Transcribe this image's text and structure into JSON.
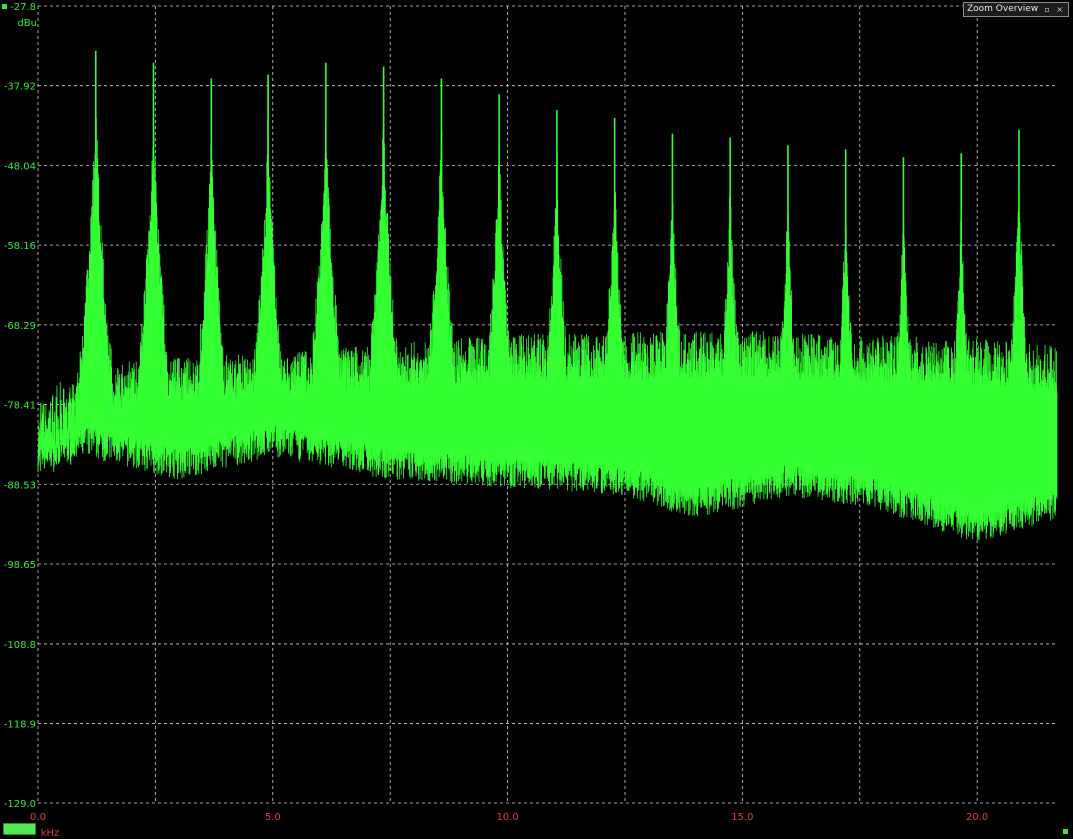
{
  "panel": {
    "title": "Zoom Overview",
    "buttons": "▫ ×"
  },
  "chart_data": {
    "type": "line",
    "xlabel": "kHz",
    "ylabel": "dBu",
    "xlim": [
      0.0,
      21.7
    ],
    "ylim": [
      -129.0,
      -27.8
    ],
    "x_ticks": [
      "0.0",
      "5.0",
      "10.0",
      "15.0",
      "20.0"
    ],
    "y_ticks": [
      "-27.8",
      "-37.92",
      "-48.04",
      "-58.16",
      "-68.29",
      "-78.41",
      "-88.53",
      "-98.65",
      "-108.8",
      "-118.9",
      "-129.0"
    ],
    "grid": true,
    "colors": {
      "trace": "#33ff33",
      "ytick": "#39e639",
      "xtick": "#e23b3b",
      "grid": "#cfcfcf",
      "background": "#000000"
    },
    "peak_spacing_khz": 1.23,
    "series": [
      {
        "peaks": [
          {
            "x": 1.23,
            "y": -33.5
          },
          {
            "x": 2.46,
            "y": -35.0
          },
          {
            "x": 3.69,
            "y": -37.0
          },
          {
            "x": 4.9,
            "y": -36.5
          },
          {
            "x": 6.13,
            "y": -35.0
          },
          {
            "x": 7.36,
            "y": -35.5
          },
          {
            "x": 8.59,
            "y": -37.0
          },
          {
            "x": 9.82,
            "y": -39.0
          },
          {
            "x": 11.05,
            "y": -41.0
          },
          {
            "x": 12.28,
            "y": -42.0
          },
          {
            "x": 13.51,
            "y": -44.0
          },
          {
            "x": 14.74,
            "y": -44.5
          },
          {
            "x": 15.97,
            "y": -45.5
          },
          {
            "x": 17.2,
            "y": -46.0
          },
          {
            "x": 18.43,
            "y": -47.0
          },
          {
            "x": 19.66,
            "y": -46.5
          },
          {
            "x": 20.89,
            "y": -43.5
          }
        ],
        "upper_envelope_between_peaks": [
          {
            "x": 0.0,
            "y": -77.0
          },
          {
            "x": 0.9,
            "y": -72.0
          },
          {
            "x": 2.0,
            "y": -68.5
          },
          {
            "x": 4.5,
            "y": -68.0
          },
          {
            "x": 10.0,
            "y": -65.5
          },
          {
            "x": 15.0,
            "y": -65.0
          },
          {
            "x": 20.0,
            "y": -66.0
          },
          {
            "x": 21.7,
            "y": -67.0
          }
        ],
        "lower_envelope": [
          {
            "x": 0.0,
            "y": -85.0
          },
          {
            "x": 1.0,
            "y": -83.0
          },
          {
            "x": 3.0,
            "y": -86.0
          },
          {
            "x": 5.0,
            "y": -83.0
          },
          {
            "x": 7.5,
            "y": -86.0
          },
          {
            "x": 10.0,
            "y": -87.0
          },
          {
            "x": 12.5,
            "y": -88.0
          },
          {
            "x": 14.0,
            "y": -91.0
          },
          {
            "x": 16.0,
            "y": -88.0
          },
          {
            "x": 18.0,
            "y": -90.0
          },
          {
            "x": 20.0,
            "y": -94.0
          },
          {
            "x": 21.7,
            "y": -91.0
          }
        ]
      }
    ]
  }
}
